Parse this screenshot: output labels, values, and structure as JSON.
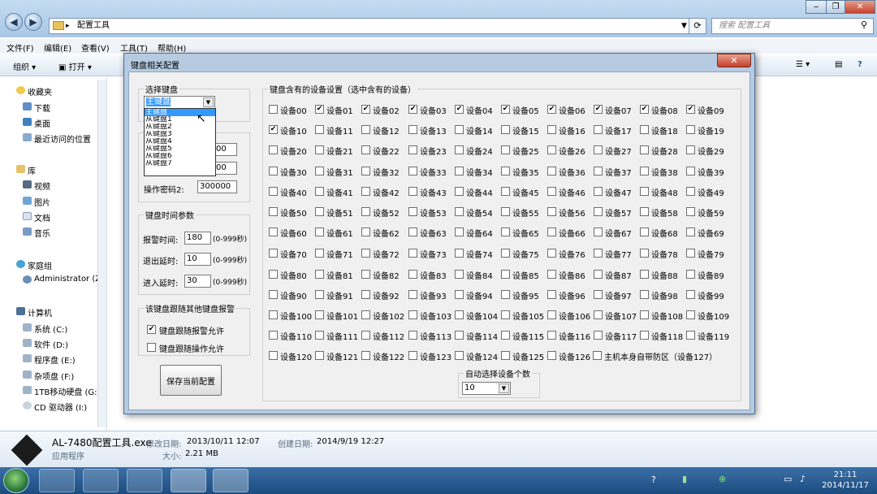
{
  "explorer": {
    "address": "配置工具",
    "search_placeholder": "搜索 配置工具",
    "menu": [
      "文件(F)",
      "编辑(E)",
      "查看(V)",
      "工具(T)",
      "帮助(H)"
    ],
    "toolbar": {
      "organize": "组织",
      "open": "打开"
    },
    "sidebar": {
      "favorites": "收藏夹",
      "downloads": "下载",
      "desktop": "桌面",
      "recent": "最近访问的位置",
      "libraries": "库",
      "videos": "视频",
      "pictures": "图片",
      "documents": "文档",
      "music": "音乐",
      "homegroup": "家庭组",
      "administrator": "Administrator (Z",
      "computer": "计算机",
      "drives": [
        "系统 (C:)",
        "软件 (D:)",
        "程序盘 (E:)",
        "杂项盘 (F:)",
        "1TB移动硬盘 (G:",
        "CD 驱动器 (I:)"
      ]
    },
    "details": {
      "filename": "AL-7480配置工具.exe",
      "modified_label": "修改日期:",
      "modified": "2013/10/11 12:07",
      "created_label": "创建日期:",
      "created": "2014/9/19 12:27",
      "type": "应用程序",
      "size_label": "大小:",
      "size": "2.21 MB"
    }
  },
  "taskbar": {
    "time": "21:11",
    "date": "2014/11/17"
  },
  "dialog": {
    "title": "键盘相关配置",
    "select_keyboard": {
      "legend": "选择键盘",
      "selected": "主键盘",
      "options": [
        "主键盘",
        "从键盘1",
        "从键盘2",
        "从键盘3",
        "从键盘4",
        "从键盘5",
        "从键盘6",
        "从键盘7"
      ]
    },
    "password": {
      "value1": "00",
      "value2": "00",
      "label3": "操作密码2:",
      "value3": "300000"
    },
    "timing": {
      "legend": "键盘时间参数",
      "alarm_label": "报警时间:",
      "alarm_value": "180",
      "alarm_range": "(0-999秒)",
      "exit_label": "退出延时:",
      "exit_value": "10",
      "exit_range": "(0-999秒)",
      "enter_label": "进入延时:",
      "enter_value": "30",
      "enter_range": "(0-999秒)"
    },
    "follow": {
      "legend": "该键盘跟随其他键盘报警",
      "alarm_allow": "键盘跟随报警允许",
      "alarm_allow_checked": true,
      "op_allow": "键盘跟随操作允许",
      "op_allow_checked": false
    },
    "save_button": "保存当前配置",
    "devices": {
      "legend": "键盘含有的设备设置（选中含有的设备）",
      "checked": [
        1,
        2,
        3,
        4,
        5,
        6,
        7,
        8,
        9,
        10
      ],
      "host_label": "主机本身自带防区（设备127）",
      "host_checked": false
    },
    "auto_select": {
      "legend": "自动选择设备个数",
      "value": "10"
    }
  }
}
